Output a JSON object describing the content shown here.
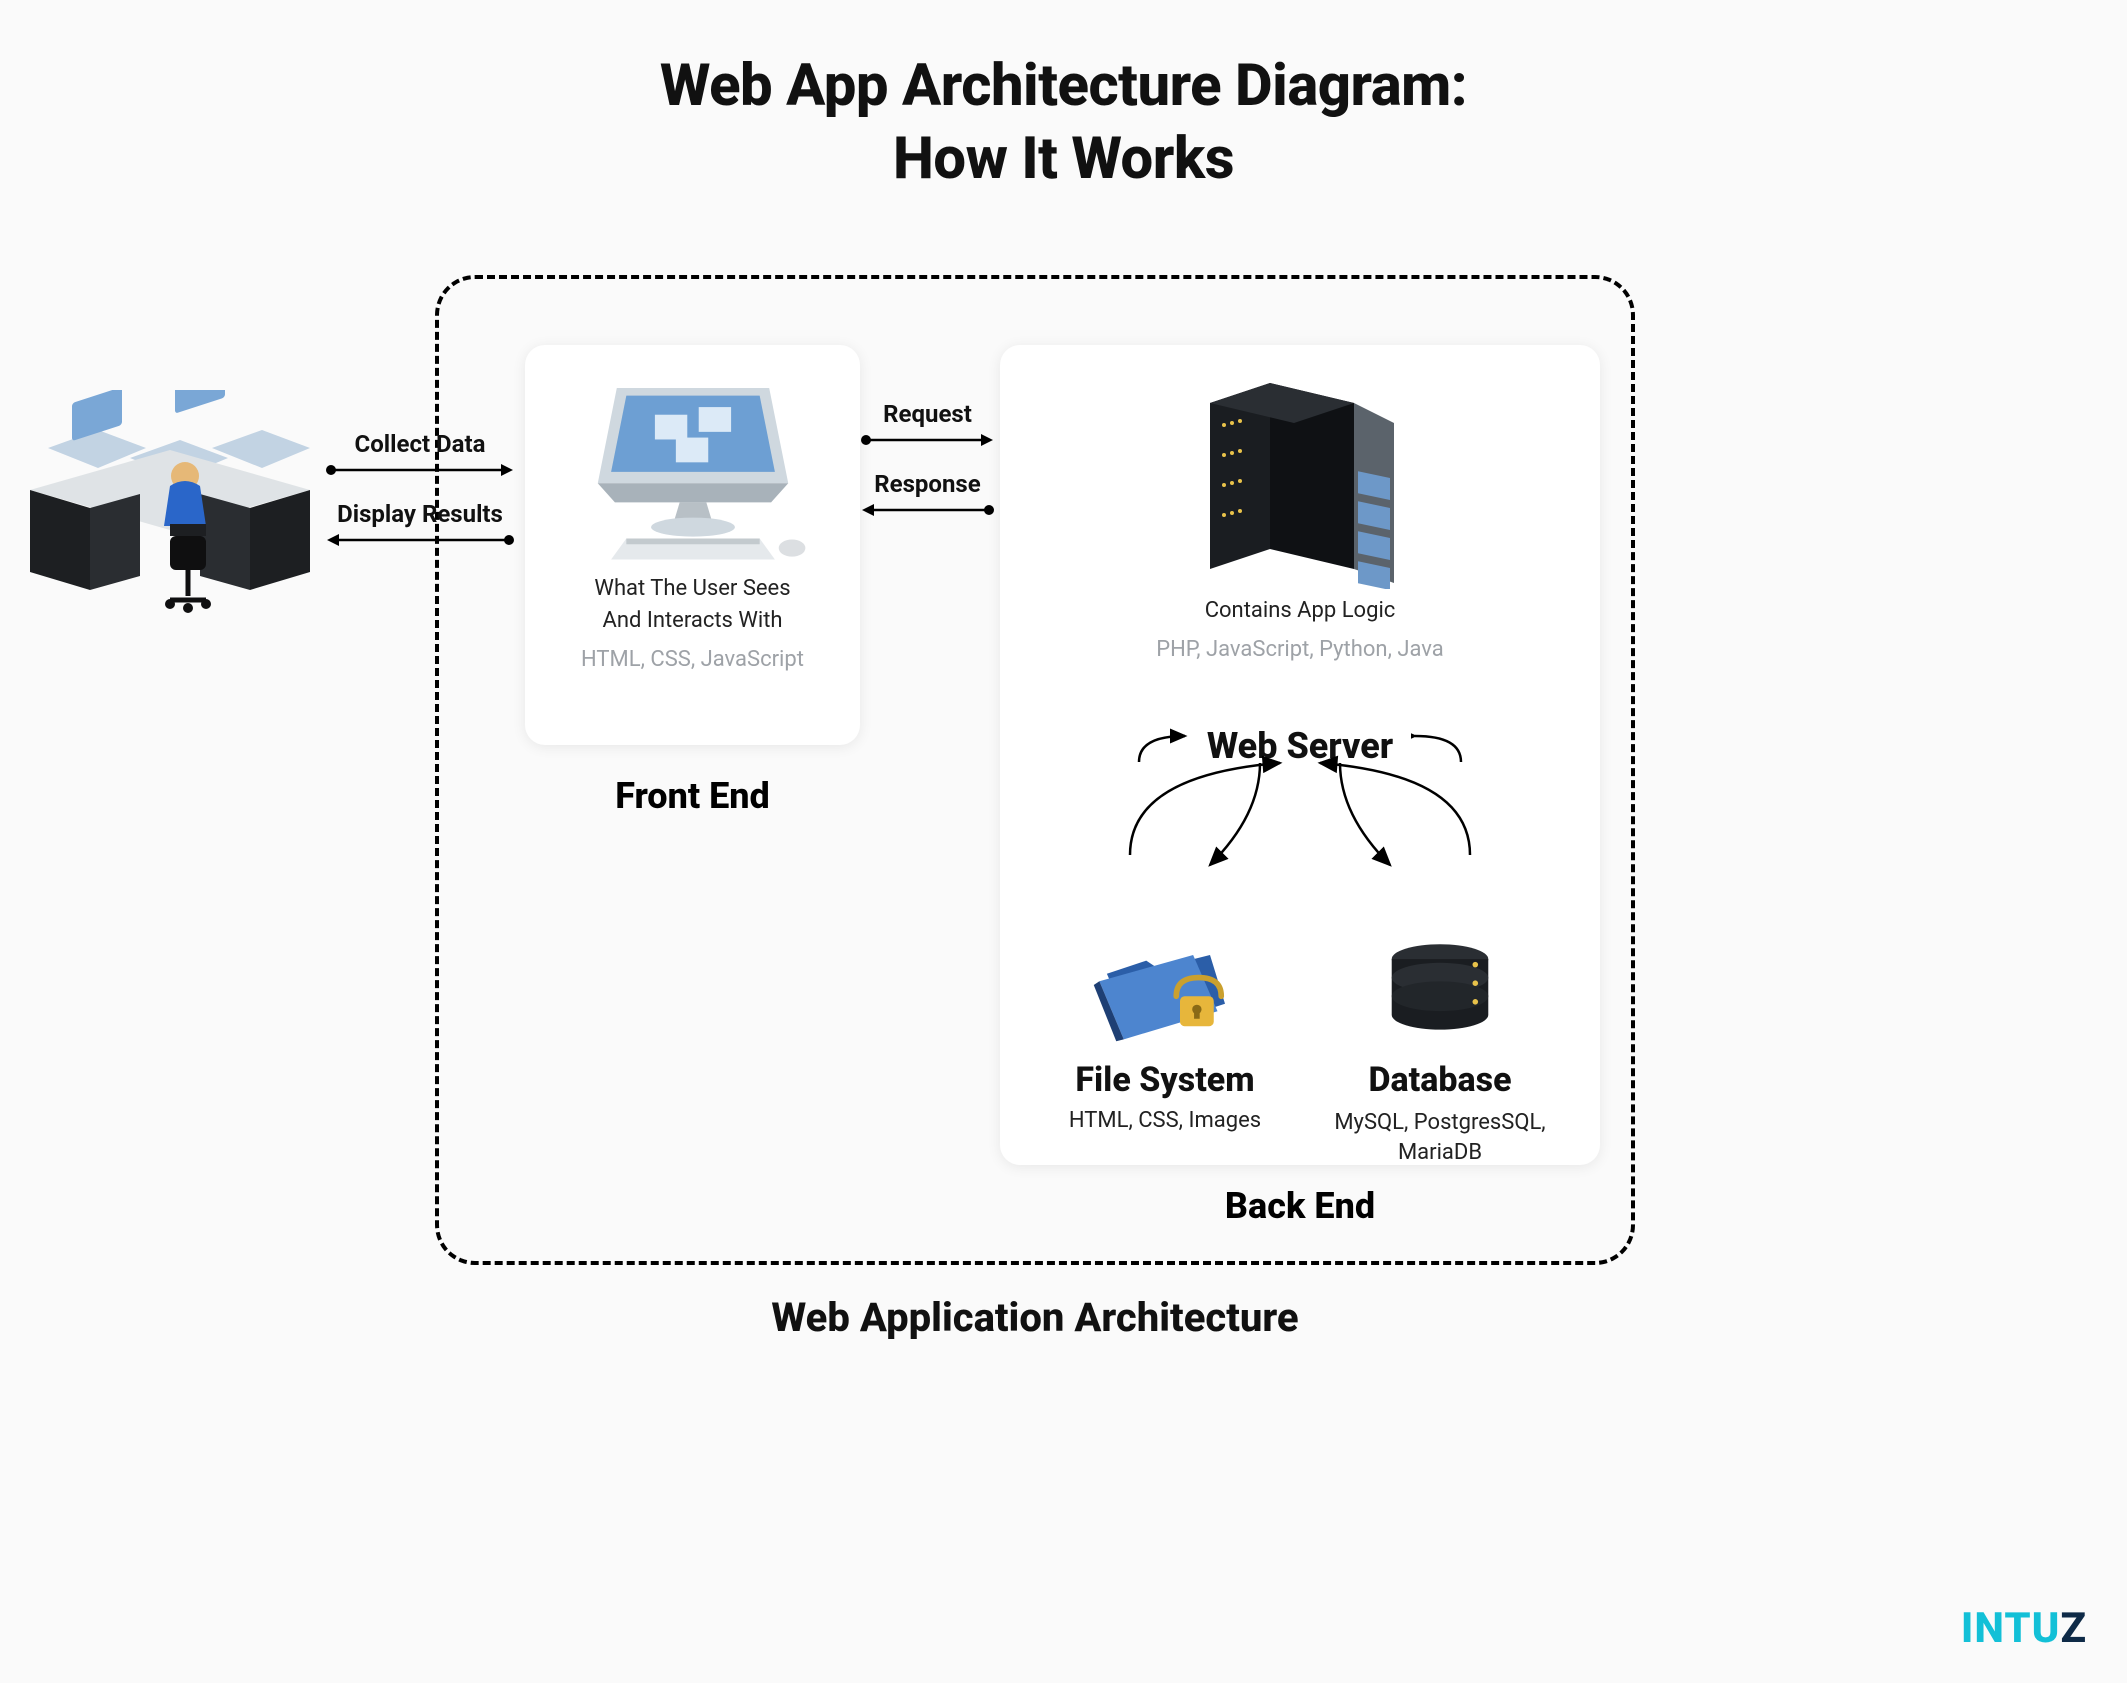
{
  "title_line1": "Web App Architecture Diagram:",
  "title_line2": "How It Works",
  "container_label": "Web Application Architecture",
  "user_frontend": {
    "top_label": "Collect Data",
    "bottom_label": "Display Results"
  },
  "frontend_backend": {
    "top_label": "Request",
    "bottom_label": "Response"
  },
  "frontend": {
    "label": "Front End",
    "desc_line1": "What The User Sees",
    "desc_line2": "And Interacts With",
    "tech": "HTML, CSS, JavaScript"
  },
  "backend": {
    "label": "Back End",
    "server_desc": "Contains App Logic",
    "server_tech": "PHP, JavaScript, Python, Java",
    "webserver_heading": "Web Server",
    "filesystem": {
      "heading": "File System",
      "tech": "HTML, CSS, Images"
    },
    "database": {
      "heading": "Database",
      "tech": "MySQL, PostgresSQL, MariaDB"
    }
  },
  "logo": {
    "part1": "INTU",
    "part2": "Z"
  }
}
